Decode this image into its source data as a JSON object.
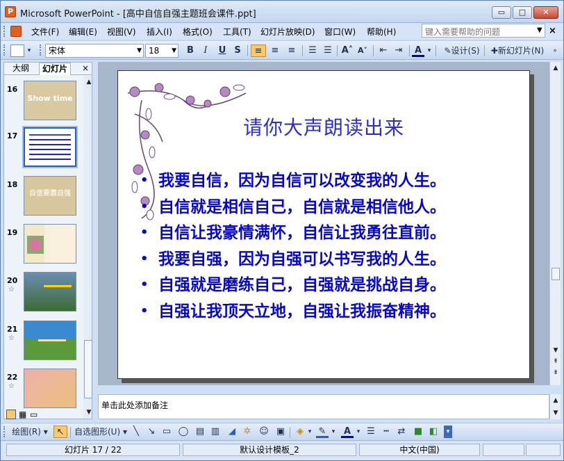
{
  "window": {
    "title": "Microsoft PowerPoint - [高中自信自强主题班会课件.ppt]",
    "app_icon": "P",
    "minimize": "▭",
    "maximize": "□",
    "close": "✕"
  },
  "menu": {
    "items": [
      "文件(F)",
      "编辑(E)",
      "视图(V)",
      "插入(I)",
      "格式(O)",
      "工具(T)",
      "幻灯片放映(D)",
      "窗口(W)",
      "帮助(H)"
    ],
    "help_placeholder": "键入需要帮助的问题",
    "dropdown_arrow": "▼",
    "close_doc": "×"
  },
  "format_toolbar": {
    "font": "宋体",
    "size": "18",
    "bold": "B",
    "italic": "I",
    "underline": "U",
    "shadow": "S",
    "design_label": "设计(S)",
    "new_slide_label": "新幻灯片(N)"
  },
  "outline_pane": {
    "tab_outline": "大纲",
    "tab_slides": "幻灯片",
    "close": "×",
    "thumbnails": [
      {
        "num": "16",
        "star": "",
        "text": "Show time"
      },
      {
        "num": "17",
        "star": "",
        "text": ""
      },
      {
        "num": "18",
        "star": "",
        "text": "自信要靠自强"
      },
      {
        "num": "19",
        "star": "",
        "text": ""
      },
      {
        "num": "20",
        "star": "☆",
        "text": ""
      },
      {
        "num": "21",
        "star": "☆",
        "text": ""
      },
      {
        "num": "22",
        "star": "☆",
        "text": ""
      }
    ]
  },
  "slide": {
    "title": "请你大声朗读出来",
    "bullet_char": "•",
    "bullets": [
      "我要自信，因为自信可以改变我的人生。",
      "自信就是相信自己，自信就是相信他人。",
      "自信让我豪情满怀，自信让我勇往直前。",
      "我要自强，因为自强可以书写我的人生。",
      "自强就是磨练自己，自强就是挑战自身。",
      "自强让我顶天立地，自强让我振奋精神。"
    ]
  },
  "notes": {
    "placeholder": "单击此处添加备注"
  },
  "drawing_toolbar": {
    "draw_label": "绘图(R)",
    "autoshapes_label": "自选图形(U)"
  },
  "status": {
    "slide_info": "幻灯片 17 / 22",
    "template": "默认设计模板_2",
    "language": "中文(中国)"
  },
  "colors": {
    "title_blue": "#2e2ec2",
    "bullet_blue": "#0707c8",
    "chrome": "#cfe0f5"
  }
}
